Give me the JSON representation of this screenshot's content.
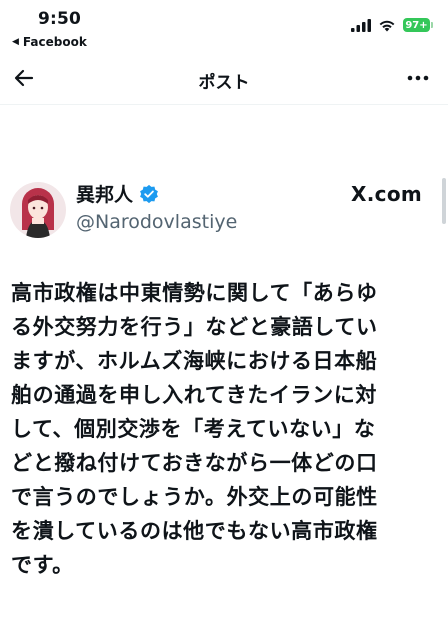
{
  "status_bar": {
    "time": "9:50",
    "back_app": "Facebook",
    "battery": "97+",
    "icons": [
      "signal-icon",
      "wifi-icon",
      "battery-icon"
    ]
  },
  "nav": {
    "title": "ポスト",
    "back_icon": "arrow-left-icon",
    "more_icon": "more-icon"
  },
  "post": {
    "display_name": "異邦人",
    "handle": "@Narodovlastiye",
    "source": "X.com",
    "verified_color": "#1d9bf0",
    "body_lines": [
      "高市政権は中東情勢に関して「あらゆ",
      "る外交努力を行う」などと豪語してい",
      "ますが、ホルムズ海峡における日本船",
      "舶の通過を申し入れてきたイランに対",
      "して、個別交渉を「考えていない」な",
      "どと撥ね付けておきながら一体どの口",
      "で言うのでしょうか。外交上の可能性",
      "を潰しているのは他でもない高市政権",
      "です。"
    ]
  },
  "colors": {
    "text": "#0f1419",
    "secondary": "#536471",
    "battery": "#34c759"
  }
}
